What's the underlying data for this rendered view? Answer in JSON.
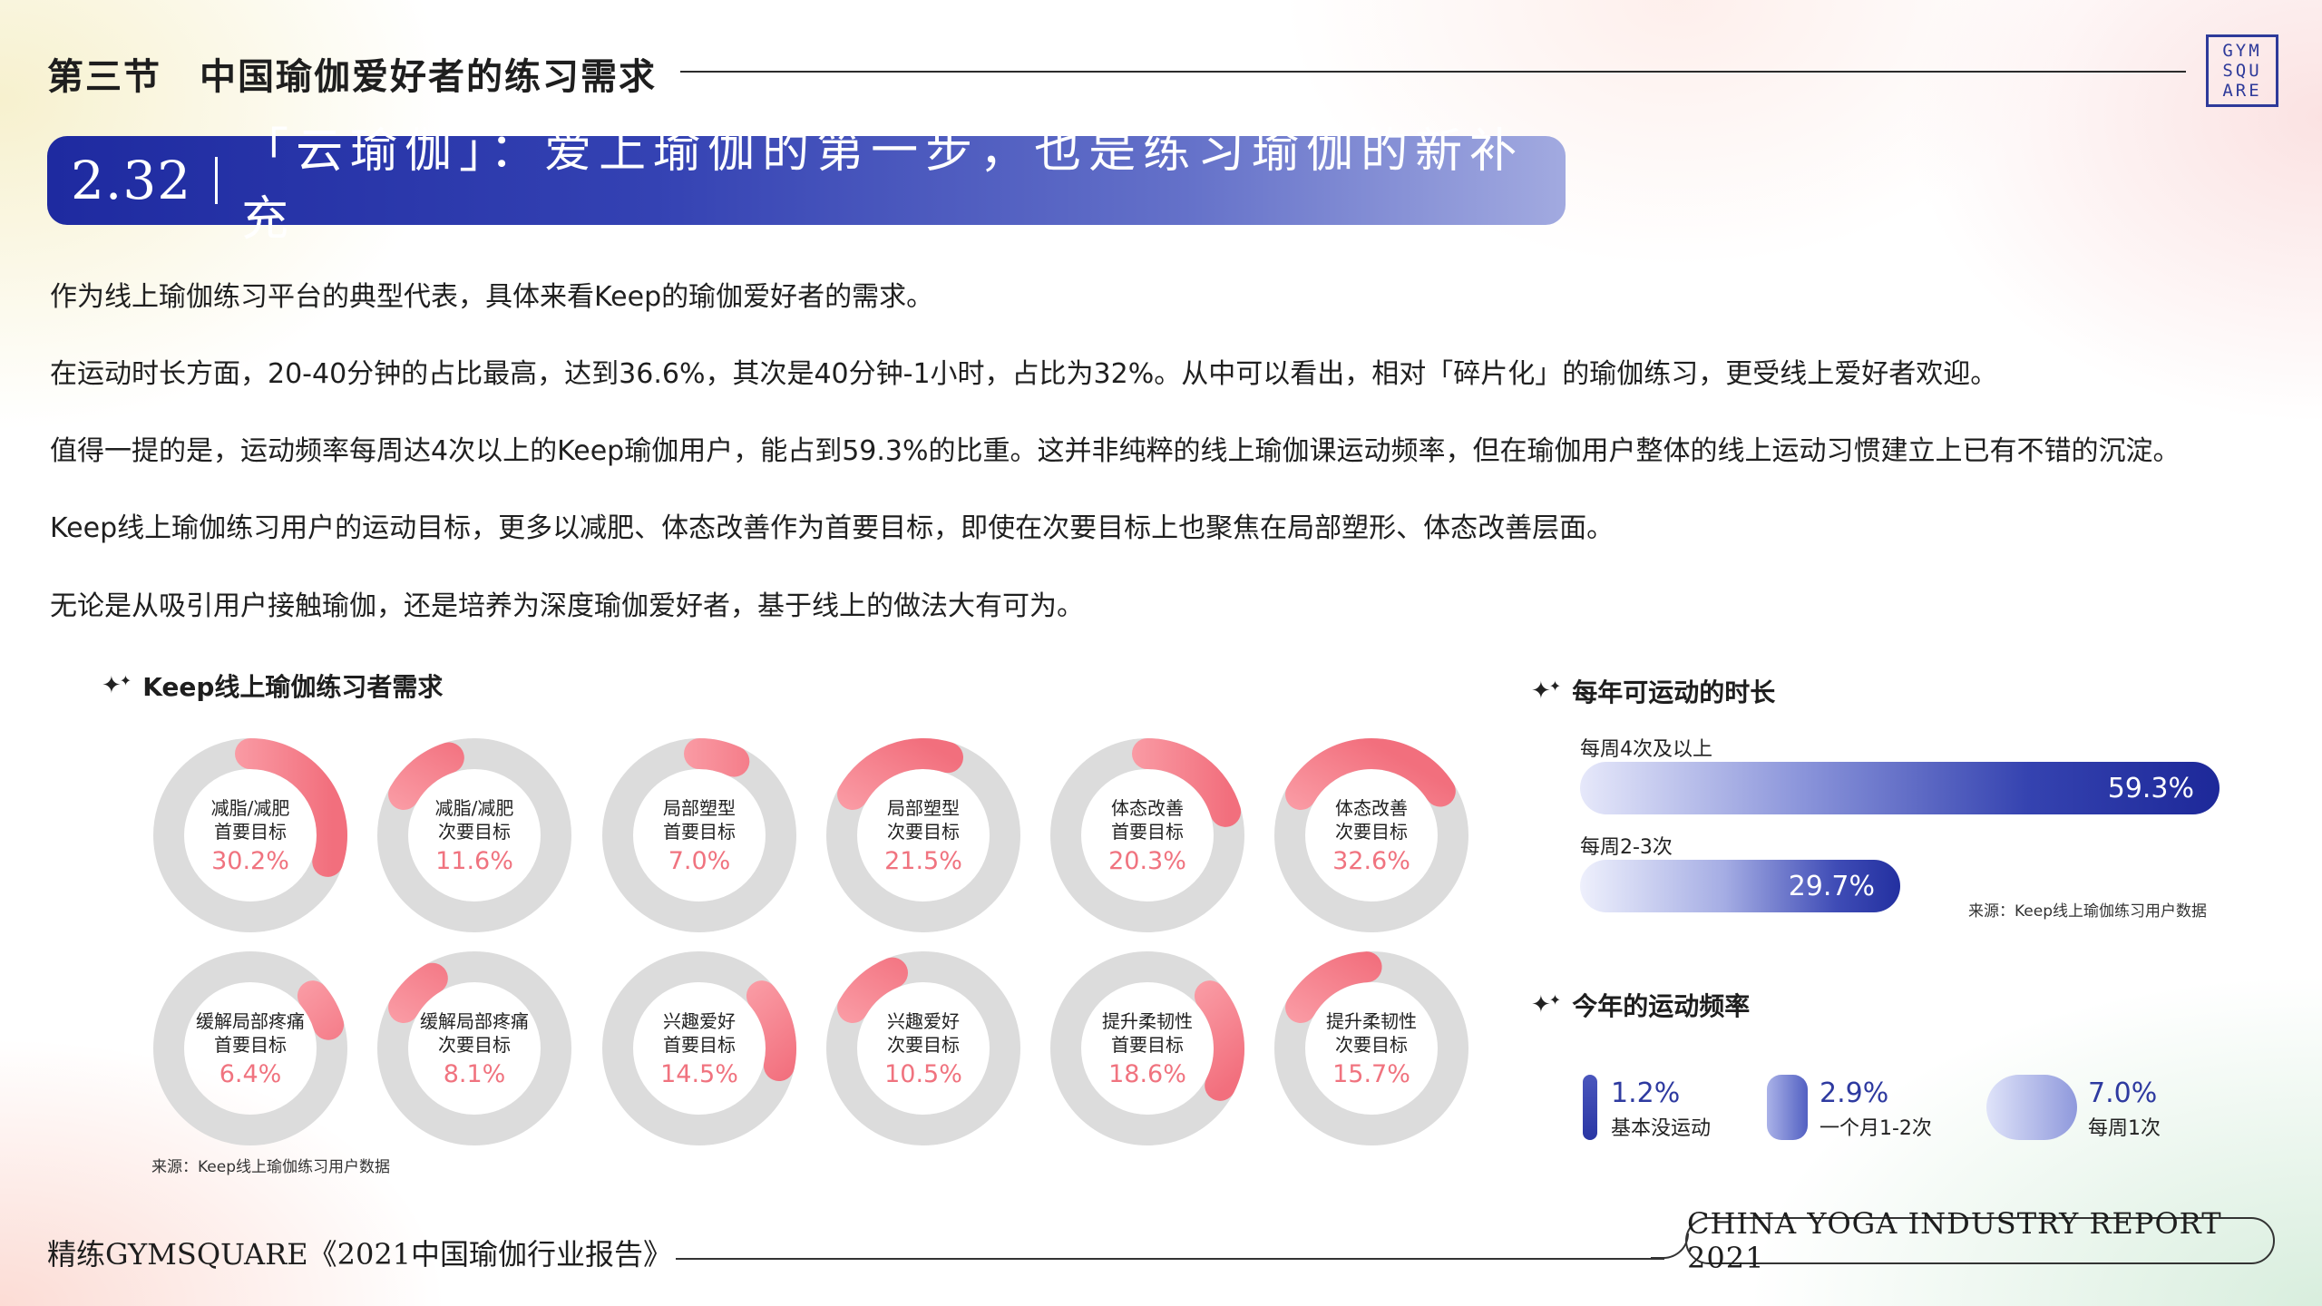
{
  "header": {
    "section_title": "第三节　中国瑜伽爱好者的练习需求",
    "logo_lines": [
      "GYM",
      "SQU",
      "ARE"
    ]
  },
  "banner": {
    "number": "2.32",
    "title": "「云瑜伽」：爱上瑜伽的第一步，也是练习瑜伽的新补充"
  },
  "paragraphs": [
    "作为线上瑜伽练习平台的典型代表，具体来看Keep的瑜伽爱好者的需求。",
    "在运动时长方面，20-40分钟的占比最高，达到36.6%，其次是40分钟-1小时，占比为32%。从中可以看出，相对「碎片化」的瑜伽练习，更受线上爱好者欢迎。",
    "值得一提的是，运动频率每周达4次以上的Keep瑜伽用户，能占到59.3%的比重。这并非纯粹的线上瑜伽课运动频率，但在瑜伽用户整体的线上运动习惯建立上已有不错的沉淀。",
    "Keep线上瑜伽练习用户的运动目标，更多以减肥、体态改善作为首要目标，即使在次要目标上也聚焦在局部塑形、体态改善层面。",
    "无论是从吸引用户接触瑜伽，还是培养为深度瑜伽爱好者，基于线上的做法大有可为。"
  ],
  "needs_panel": {
    "title": "Keep线上瑜伽练习者需求",
    "source": "来源：Keep线上瑜伽练习用户数据",
    "colors": {
      "track": "#dcdcdc",
      "arc_start": "#ffb9bf",
      "arc_end": "#f26f7d"
    }
  },
  "chart_data": [
    {
      "type": "pie",
      "title": "Keep线上瑜伽练习者需求",
      "series": [
        {
          "line1": "减脂/减肥",
          "line2": "首要目标",
          "value": 30.2,
          "display": "30.2%"
        },
        {
          "line1": "减脂/减肥",
          "line2": "次要目标",
          "value": 11.6,
          "display": "11.6%"
        },
        {
          "line1": "局部塑型",
          "line2": "首要目标",
          "value": 7.0,
          "display": "7.0%"
        },
        {
          "line1": "局部塑型",
          "line2": "次要目标",
          "value": 21.5,
          "display": "21.5%"
        },
        {
          "line1": "体态改善",
          "line2": "首要目标",
          "value": 20.3,
          "display": "20.3%"
        },
        {
          "line1": "体态改善",
          "line2": "次要目标",
          "value": 32.6,
          "display": "32.6%"
        },
        {
          "line1": "缓解局部疼痛",
          "line2": "首要目标",
          "value": 6.4,
          "display": "6.4%"
        },
        {
          "line1": "缓解局部疼痛",
          "line2": "次要目标",
          "value": 8.1,
          "display": "8.1%"
        },
        {
          "line1": "兴趣爱好",
          "line2": "首要目标",
          "value": 14.5,
          "display": "14.5%"
        },
        {
          "line1": "兴趣爱好",
          "line2": "次要目标",
          "value": 10.5,
          "display": "10.5%"
        },
        {
          "line1": "提升柔韧性",
          "line2": "首要目标",
          "value": 18.6,
          "display": "18.6%"
        },
        {
          "line1": "提升柔韧性",
          "line2": "次要目标",
          "value": 15.7,
          "display": "15.7%"
        }
      ]
    },
    {
      "type": "bar",
      "title": "每年可运动的时长",
      "categories": [
        "每周4次及以上",
        "每周2-3次"
      ],
      "values": [
        59.3,
        29.7
      ],
      "display": [
        "59.3%",
        "29.7%"
      ],
      "source": "来源：Keep线上瑜伽练习用户数据"
    },
    {
      "type": "bar",
      "title": "今年的运动频率",
      "categories": [
        "基本没运动",
        "一个月1-2次",
        "每周1次"
      ],
      "values": [
        1.2,
        2.9,
        7.0
      ],
      "display": [
        "1.2%",
        "2.9%",
        "7.0%"
      ]
    }
  ],
  "footer": {
    "left": "精练GYMSQUARE《2021中国瑜伽行业报告》",
    "right": "CHINA YOGA INDUSTRY REPORT 2021"
  }
}
